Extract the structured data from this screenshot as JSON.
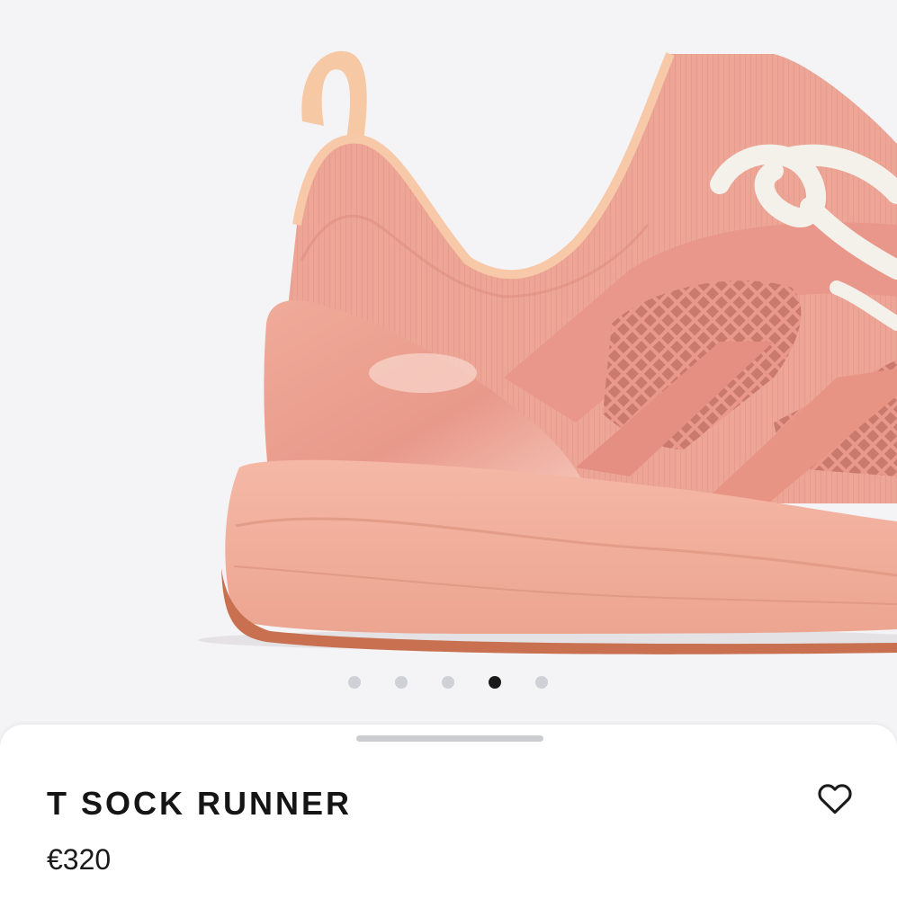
{
  "product": {
    "name": "T SOCK RUNNER",
    "price": "€320",
    "image_icon": "sneaker-image",
    "favorite_icon": "heart-outline-icon"
  },
  "gallery": {
    "total_images": 5,
    "active_index": 3
  },
  "colors": {
    "background": "#f4f4f6",
    "shoe_body": "#eea594",
    "shoe_sole": "#f2b09d",
    "outsole": "#c8704f",
    "laces": "#f3f1ea",
    "active_dot": "#1a1a1a",
    "inactive_dot": "#cfd1d6"
  }
}
